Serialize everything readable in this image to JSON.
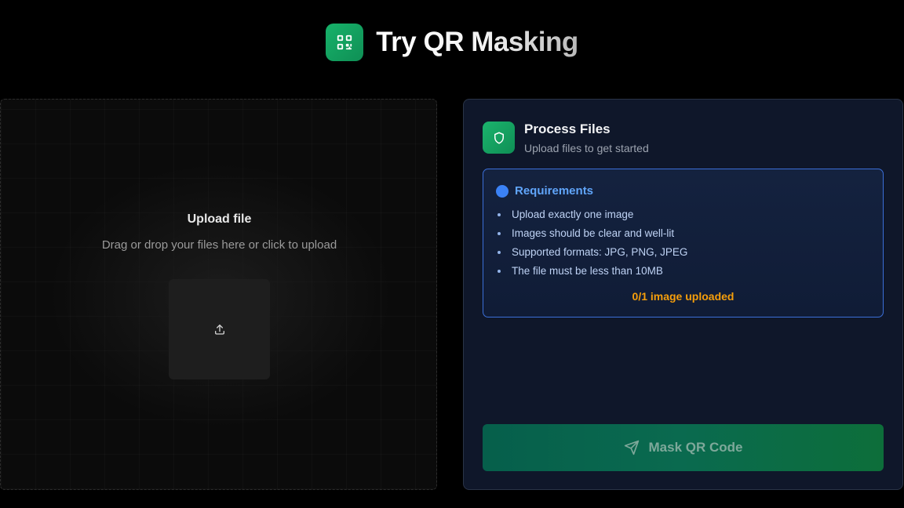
{
  "header": {
    "title": "Try QR Masking",
    "logo_icon": "qr-code-icon",
    "accent": "#17b26a"
  },
  "upload": {
    "title": "Upload file",
    "subtitle": "Drag or drop your files here or click to upload",
    "icon": "upload-icon"
  },
  "panel": {
    "title": "Process Files",
    "subtitle": "Upload files to get started",
    "icon": "shield-icon",
    "requirements": {
      "title": "Requirements",
      "items": [
        "Upload exactly one image",
        "Images should be clear and well-lit",
        "Supported formats: JPG, PNG, JPEG",
        "The file must be less than 10MB"
      ],
      "count": "0/1 image uploaded",
      "border_color": "#3b6fd8",
      "count_color": "#f59e0b"
    },
    "action": {
      "label": "Mask QR Code",
      "icon": "send-icon"
    }
  }
}
